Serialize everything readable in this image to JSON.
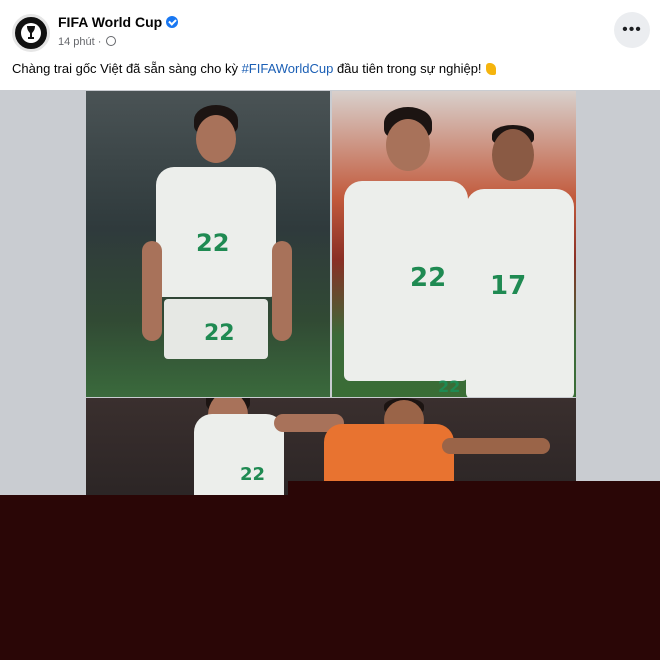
{
  "post": {
    "page_name": "FIFA World Cup",
    "time": "14 phút",
    "more_label": "•••",
    "caption_before": "Chàng trai gốc Việt đã sẵn sàng cho kỳ ",
    "hashtag": "#FIFAWorldCup",
    "caption_after": " đầu tiên trong sự nghiệp!"
  },
  "photos": {
    "p1_number": "22",
    "p1_shorts_number": "22",
    "p2_left_number": "22",
    "p2_right_number": "17",
    "p2_shorts_number": "22",
    "p3_number": "22"
  },
  "icons": {
    "avatar": "fifa-trophy-logo",
    "verified": "verified-badge-icon",
    "audience": "globe-icon",
    "emoji": "flexed-biceps-emoji"
  },
  "colors": {
    "verified": "#1877f2",
    "hashtag": "#1b5fb5",
    "jersey_number": "#1f8a52",
    "orange_kit": "#e87330"
  }
}
